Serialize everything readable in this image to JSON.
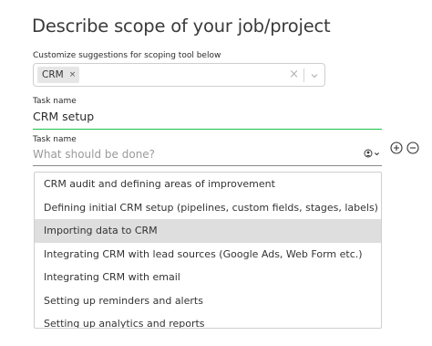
{
  "title": "Describe scope of your job/project",
  "customize": {
    "label": "Customize suggestions for scoping tool below",
    "selected_tag": "CRM",
    "chip_remove": "×",
    "clear": "×"
  },
  "task1": {
    "label": "Task name",
    "value": "CRM setup"
  },
  "task2": {
    "label": "Task name",
    "placeholder": "What should be done?"
  },
  "suggestions": [
    "CRM audit and defining areas of improvement",
    "Defining initial CRM setup (pipelines, custom fields, stages, labels)",
    "Importing data to CRM",
    "Integrating CRM with lead sources (Google Ads, Web Form etc.)",
    "Integrating CRM with email",
    "Setting up reminders and alerts",
    "Setting up analytics and reports"
  ],
  "highlighted_index": 2,
  "colors": {
    "focus_underline": "#1ec24a",
    "highlight": "#dedede"
  }
}
